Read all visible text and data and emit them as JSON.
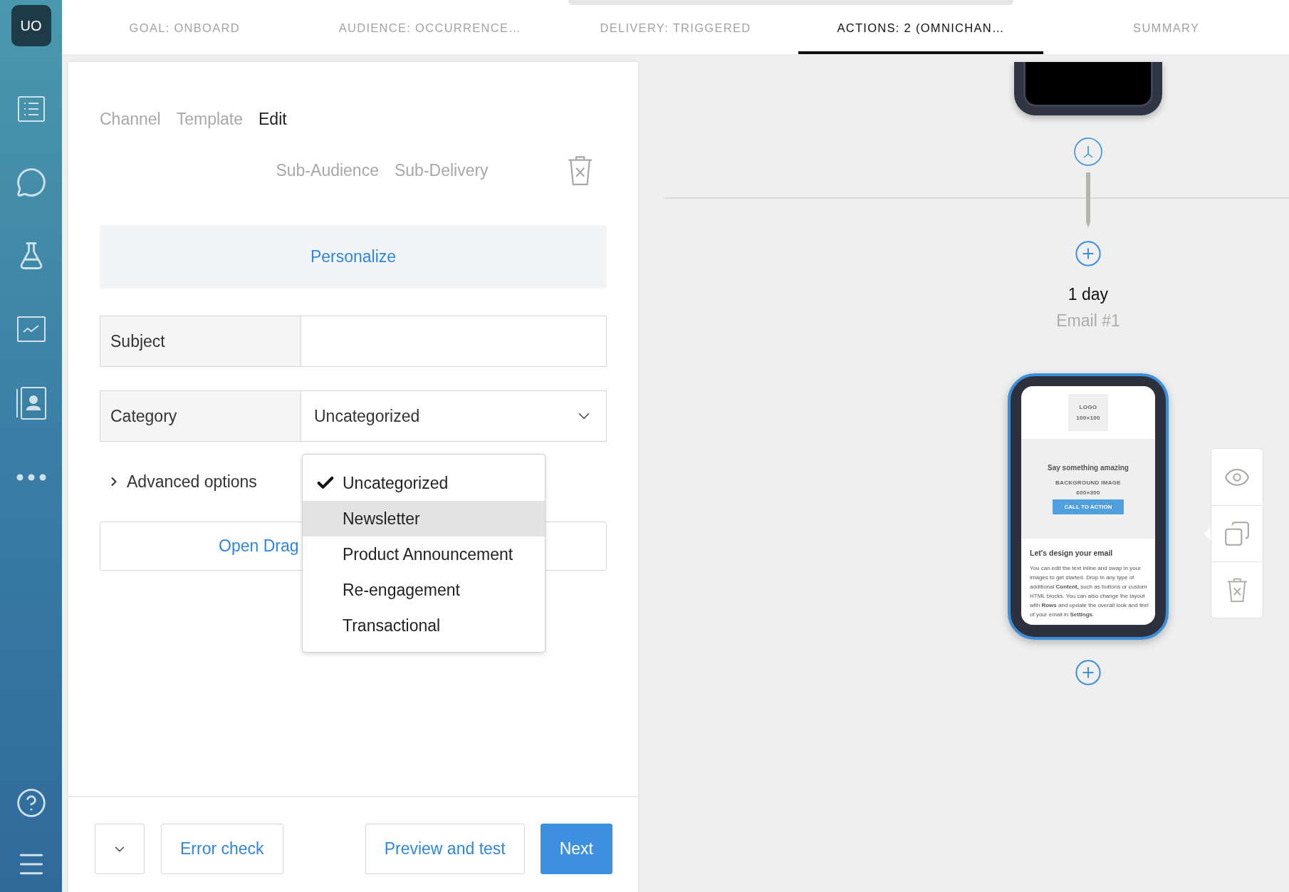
{
  "sidebar": {
    "avatar": "UO"
  },
  "steps": [
    {
      "label": "GOAL: ONBOARD",
      "selected": false
    },
    {
      "label": "AUDIENCE: OCCURRENCE…",
      "selected": false
    },
    {
      "label": "DELIVERY: TRIGGERED",
      "selected": false
    },
    {
      "label": "ACTIONS: 2 (OMNICHAN…",
      "selected": true
    },
    {
      "label": "SUMMARY",
      "selected": false
    }
  ],
  "editor": {
    "tabs": [
      {
        "label": "Channel",
        "selected": false
      },
      {
        "label": "Template",
        "selected": false
      },
      {
        "label": "Edit",
        "selected": true
      }
    ],
    "sub_tabs": [
      {
        "label": "Sub-Audience"
      },
      {
        "label": "Sub-Delivery"
      }
    ],
    "personalize": "Personalize",
    "fields": [
      {
        "kind": "text",
        "label": "Subject"
      },
      {
        "kind": "select",
        "label": "Category",
        "value": "Uncategorized"
      }
    ],
    "advanced": {
      "label": "Advanced options",
      "expanded": false
    },
    "open_editor": "Open Drag",
    "category_menu": {
      "options": [
        {
          "label": "Uncategorized",
          "checked": true,
          "selected": false
        },
        {
          "label": "Newsletter",
          "checked": false,
          "selected": true
        },
        {
          "label": "Product Announcement",
          "checked": false,
          "selected": false
        },
        {
          "label": "Re-engagement",
          "checked": false,
          "selected": false
        },
        {
          "label": "Transactional",
          "checked": false,
          "selected": false
        }
      ]
    }
  },
  "footer": {
    "start": [
      {
        "kind": "menu"
      },
      {
        "kind": "outline",
        "label": "Error check"
      }
    ],
    "end": [
      {
        "kind": "outline",
        "label": "Preview and test"
      },
      {
        "kind": "primary",
        "label": "Next"
      }
    ]
  },
  "canvas": {
    "delay": "1 day",
    "step_name": "Email #1",
    "email": {
      "selected": true,
      "logo": "LOGO",
      "logo_size": "100×100",
      "headline": "Say something amazing",
      "bg_label": "BACKGROUND IMAGE",
      "bg_size": "600×300",
      "cta": "CALL TO ACTION",
      "heading": "Let's design your email",
      "body": "You can edit the text inline and swap in your images to get started. Drop in any type of additional **Content,** such as buttons or custom HTML blocks. You can also change the layout with **Rows** and update the overall look and feel of your email in **Settings**."
    }
  }
}
